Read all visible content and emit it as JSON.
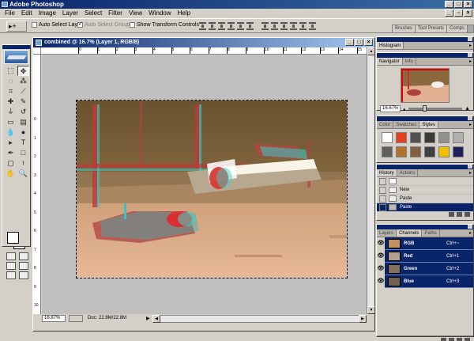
{
  "app": {
    "title": "Adobe Photoshop"
  },
  "menu": [
    "File",
    "Edit",
    "Image",
    "Layer",
    "Select",
    "Filter",
    "View",
    "Window",
    "Help"
  ],
  "options": {
    "tool_glyph": "▸+",
    "auto_select_layer": "Auto Select Layer",
    "auto_select_groups": "Auto Select Groups",
    "show_transform_controls": "Show Transform Controls"
  },
  "palette_well": [
    "Brushes",
    "Tool Presets",
    "Comps"
  ],
  "document": {
    "title": "combined @ 16.7% (Layer 1, RGB/8)",
    "zoom": "16.67%",
    "doc_size": "Doc: 22.8M/22.8M",
    "ruler_h": [
      "0",
      "1",
      "2",
      "3",
      "4",
      "5",
      "6",
      "7",
      "8",
      "9",
      "10",
      "11",
      "12",
      "13",
      "14",
      "15"
    ],
    "ruler_v": [
      "0",
      "1",
      "2",
      "3",
      "4",
      "5",
      "6",
      "7",
      "8",
      "9",
      "10"
    ]
  },
  "panels": {
    "histogram": {
      "tab": "Histogram"
    },
    "navigator": {
      "tabs": [
        "Navigator",
        "Info"
      ],
      "zoom": "16.67%"
    },
    "styles": {
      "tabs": [
        "Color",
        "Swatches",
        "Styles"
      ],
      "swatches": [
        "#ffffff",
        "#e04020",
        "#505050",
        "#3a3a3a",
        "#909090",
        "#b0b0b0",
        "#606060",
        "#b07030",
        "#806040",
        "#404040",
        "#f0c000",
        "#202060"
      ]
    },
    "history": {
      "tabs": [
        "History",
        "Actions"
      ],
      "items": [
        {
          "label": ""
        },
        {
          "label": "New"
        },
        {
          "label": "Paste"
        },
        {
          "label": "Paste"
        }
      ]
    },
    "channels": {
      "tabs": [
        "Layers",
        "Channels",
        "Paths"
      ],
      "rows": [
        {
          "name": "RGB",
          "shortcut": "Ctrl+~",
          "color": "#c09060"
        },
        {
          "name": "Red",
          "shortcut": "Ctrl+1",
          "color": "#b0a090"
        },
        {
          "name": "Green",
          "shortcut": "Ctrl+2",
          "color": "#807060"
        },
        {
          "name": "Blue",
          "shortcut": "Ctrl+3",
          "color": "#706050"
        }
      ]
    }
  }
}
